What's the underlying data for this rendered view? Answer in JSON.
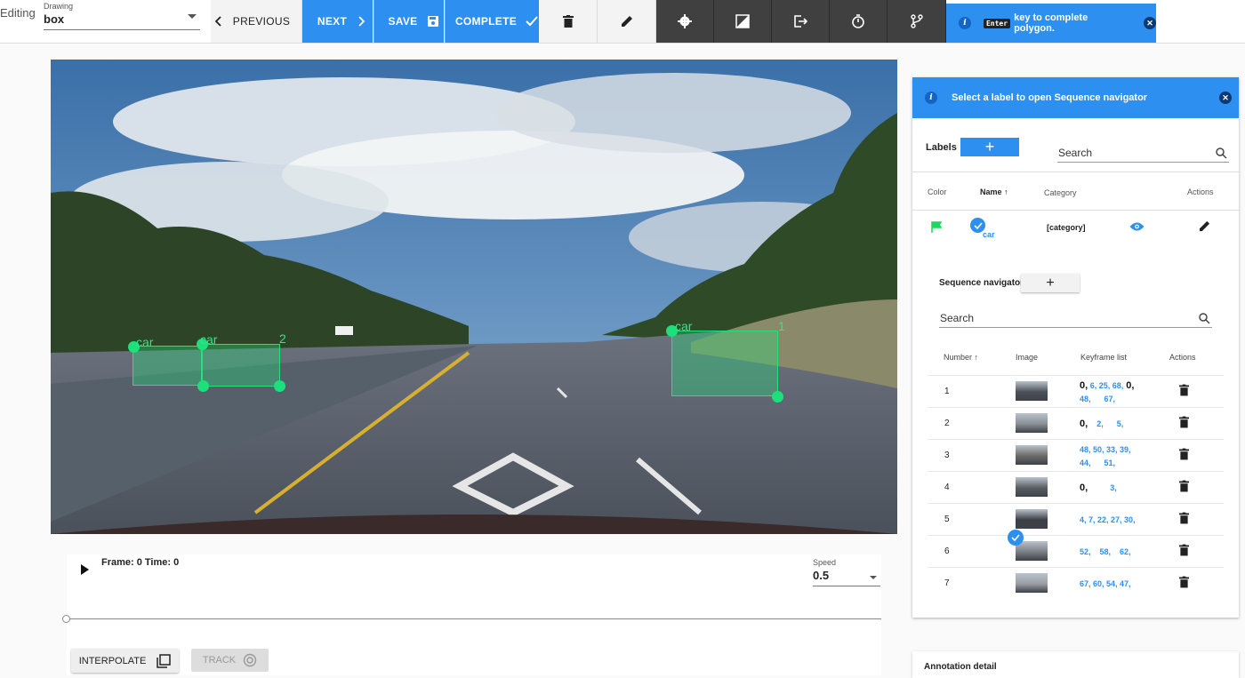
{
  "toolbar": {
    "mode_label": "Editing",
    "drawing_caption": "Drawing",
    "drawing_value": "box",
    "previous_label": "PREVIOUS",
    "next_label": "NEXT",
    "save_label": "SAVE",
    "complete_label": "COMPLETE",
    "icons": [
      "chevron-left-icon",
      "chevron-right-icon",
      "save-icon",
      "check-icon",
      "trash-icon",
      "pencil-icon",
      "gear-icon",
      "brightness-icon",
      "exit-icon",
      "timer-icon",
      "branch-icon"
    ]
  },
  "hint": {
    "key": "Enter",
    "text": "key to complete polygon."
  },
  "scene": {
    "boxes": [
      {
        "label": "car",
        "number": ""
      },
      {
        "label": "car",
        "number": "2"
      },
      {
        "label": "car",
        "number": "1"
      }
    ],
    "box_color": "#26e07a"
  },
  "timeline": {
    "frame_text": "Frame: 0 Time: 0",
    "speed_caption": "Speed",
    "speed_value": "0.5",
    "interpolate_label": "INTERPOLATE",
    "track_label": "TRACK"
  },
  "panel": {
    "banner_text": "Select a label to open Sequence navigator",
    "labels_title": "Labels",
    "search_placeholder": "Search",
    "columns": {
      "color": "Color",
      "name": "Name",
      "category": "Category",
      "actions": "Actions"
    },
    "label_row": {
      "name": "car",
      "category": "[category]",
      "color": "#1ed760"
    },
    "sequence_title": "Sequence navigator",
    "seq_search_placeholder": "Search",
    "seq_columns": {
      "number": "Number",
      "image": "Image",
      "keyframes": "Keyframe list",
      "actions": "Actions"
    },
    "sequences": [
      {
        "number": "1",
        "kf_line1_bold": "0,",
        "kf_line1": " 6, 25, 68,",
        "kf_line1_bold2": " 0,",
        "kf_line2": "48,      67,"
      },
      {
        "number": "2",
        "kf_line1_bold": "0,",
        "kf_line1": "    2,      5,",
        "kf_line1_bold2": "",
        "kf_line2": ""
      },
      {
        "number": "3",
        "kf_line1_bold": "",
        "kf_line1": "48, 50, 33, 39,",
        "kf_line1_bold2": "",
        "kf_line2": "44,      51,"
      },
      {
        "number": "4",
        "kf_line1_bold": "0,",
        "kf_line1": "          3,",
        "kf_line1_bold2": "",
        "kf_line2": ""
      },
      {
        "number": "5",
        "kf_line1_bold": "",
        "kf_line1": "4, 7, 22, 27, 30,",
        "kf_line1_bold2": "",
        "kf_line2": ""
      },
      {
        "number": "6",
        "kf_line1_bold": "",
        "kf_line1": "52,    58,    62,",
        "kf_line1_bold2": "",
        "kf_line2": ""
      },
      {
        "number": "7",
        "kf_line1_bold": "",
        "kf_line1": "67, 60, 54, 47,",
        "kf_line1_bold2": "",
        "kf_line2": ""
      }
    ]
  },
  "annotation_detail": "Annotation detail",
  "colors": {
    "accent": "#2d8ff0",
    "dark_toolbar": "#404040",
    "box": "#26e07a"
  }
}
